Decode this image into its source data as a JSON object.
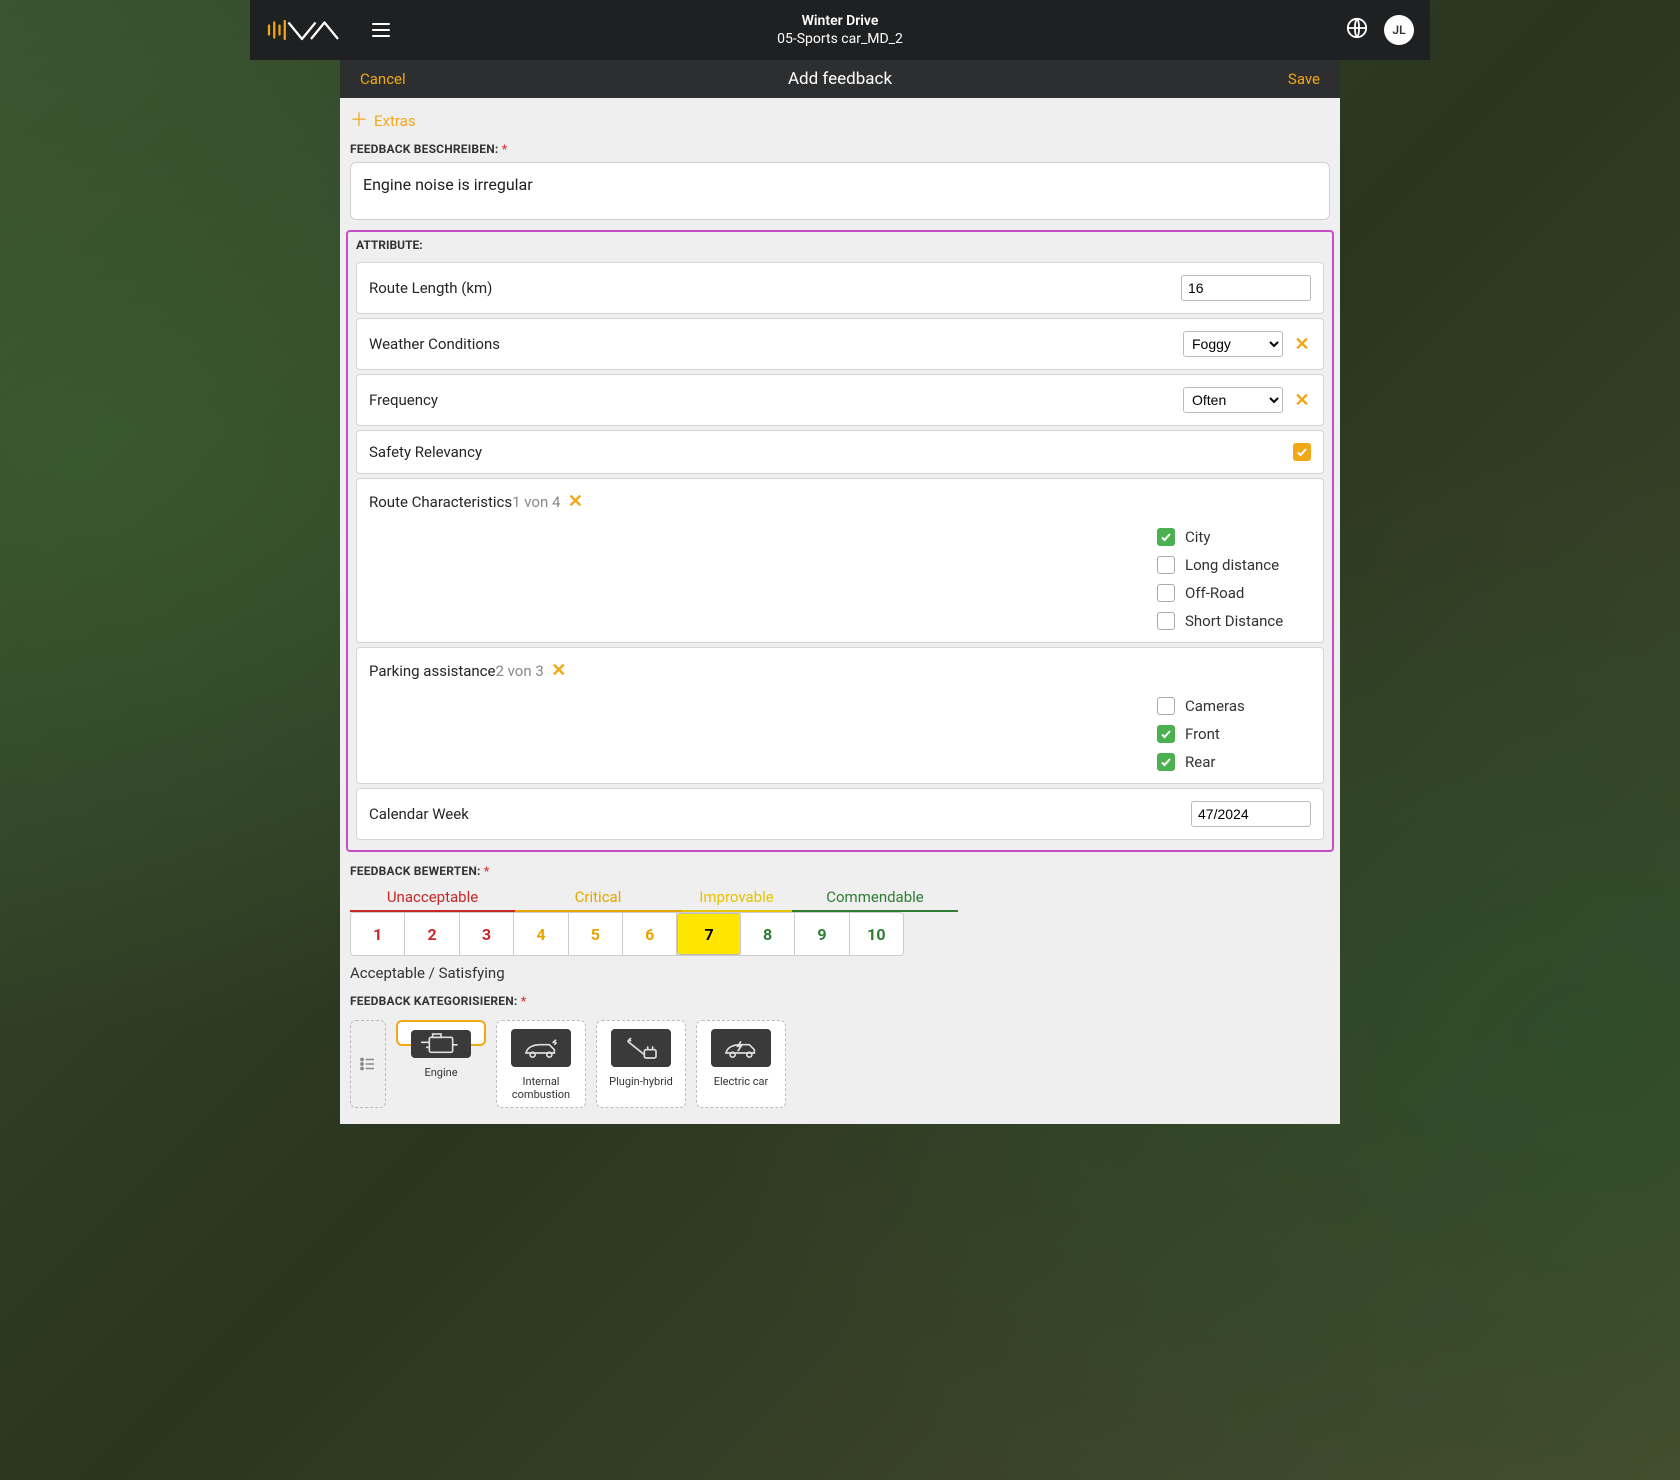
{
  "header": {
    "title_line1": "Winter Drive",
    "title_line2": "05-Sports car_MD_2",
    "avatar_initials": "JL"
  },
  "subheader": {
    "cancel": "Cancel",
    "title": "Add feedback",
    "save": "Save"
  },
  "extras_label": "Extras",
  "sections": {
    "describe": "FEEDBACK BESCHREIBEN:",
    "attribute": "ATTRIBUTE:",
    "rate": "FEEDBACK BEWERTEN:",
    "categorize": "FEEDBACK KATEGORISIEREN:"
  },
  "feedback_text": "Engine noise is irregular",
  "attributes": {
    "route_length": {
      "label": "Route Length (km)",
      "value": "16"
    },
    "weather": {
      "label": "Weather Conditions",
      "value": "Foggy"
    },
    "frequency": {
      "label": "Frequency",
      "value": "Often"
    },
    "safety": {
      "label": "Safety Relevancy",
      "checked": true
    },
    "route_char": {
      "label": "Route Characteristics",
      "count": "1 von 4",
      "options": [
        {
          "label": "City",
          "checked": true
        },
        {
          "label": "Long distance",
          "checked": false
        },
        {
          "label": "Off-Road",
          "checked": false
        },
        {
          "label": "Short Distance",
          "checked": false
        }
      ]
    },
    "parking": {
      "label": "Parking assistance",
      "count": "2 von 3",
      "options": [
        {
          "label": "Cameras",
          "checked": false
        },
        {
          "label": "Front",
          "checked": true
        },
        {
          "label": "Rear",
          "checked": true
        }
      ]
    },
    "calweek": {
      "label": "Calendar Week",
      "value": "47/2024"
    }
  },
  "rating": {
    "groups": {
      "unacceptable": "Unacceptable",
      "critical": "Critical",
      "improvable": "Improvable",
      "commendable": "Commendable"
    },
    "values": [
      "1",
      "2",
      "3",
      "4",
      "5",
      "6",
      "7",
      "8",
      "9",
      "10"
    ],
    "selected": "7",
    "note": "Acceptable / Satisfying"
  },
  "categories": [
    {
      "key": "engine",
      "label": "Engine",
      "selected": true
    },
    {
      "key": "internal",
      "label": "Internal combustion",
      "selected": false
    },
    {
      "key": "plugin",
      "label": "Plugin-hybrid",
      "selected": false
    },
    {
      "key": "electric",
      "label": "Electric car",
      "selected": false
    }
  ]
}
